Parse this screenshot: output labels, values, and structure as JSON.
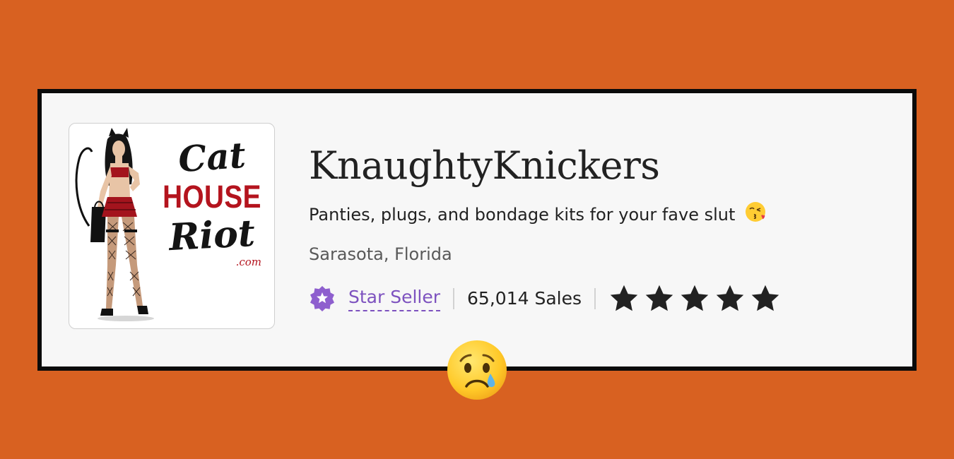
{
  "shop": {
    "logo_text": {
      "line1": "Cat",
      "line2": "HOUSE",
      "line3": "Riot",
      "line4": ".com"
    },
    "name": "KnaughtyKnickers",
    "tagline": "Panties, plugs, and bondage kits for your fave slut",
    "tagline_emoji_icon": "kissing-face-icon",
    "location": "Sarasota, Florida",
    "star_seller_label": "Star Seller",
    "sales": "65,014 Sales",
    "rating_stars": 5,
    "rating_max": 5
  },
  "overlay": {
    "emoji_icon": "crying-face-icon"
  },
  "colors": {
    "background": "#D86121",
    "card": "#F7F7F7",
    "card_border": "#0B0B0B",
    "star_seller_purple": "#7D52BF",
    "logo_red": "#B4141E",
    "text_primary": "#222222",
    "text_secondary": "#595959"
  }
}
